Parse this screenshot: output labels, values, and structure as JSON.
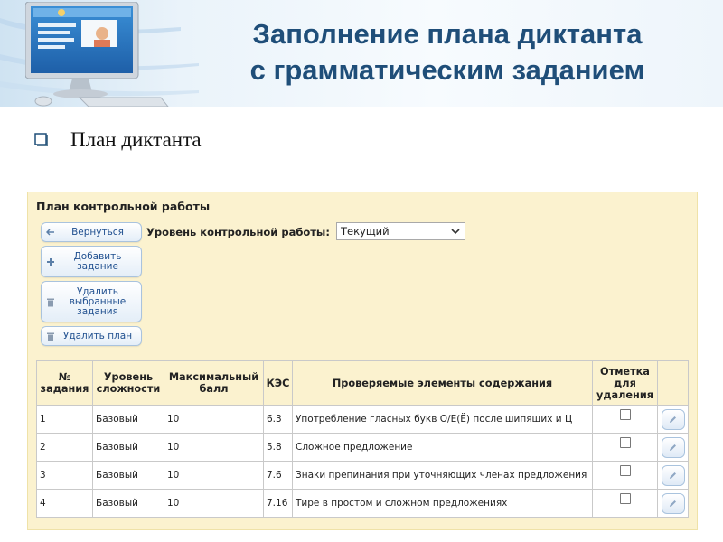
{
  "slide": {
    "title_line1": "Заполнение плана диктанта",
    "title_line2": "с грамматическим заданием",
    "bullet_text": "План диктанта"
  },
  "app": {
    "panel_title": "План контрольной работы",
    "buttons": {
      "back": "Вернуться",
      "add": "Добавить задание",
      "delete_selected": "Удалить выбранные задания",
      "delete_plan": "Удалить план"
    },
    "level_label": "Уровень контрольной работы:",
    "level_value": "Текущий",
    "table": {
      "headers": [
        "№ задания",
        "Уровень сложности",
        "Максимальный балл",
        "КЭС",
        "Проверяемые элементы содержания",
        "Отметка для удаления",
        ""
      ],
      "rows": [
        {
          "num": "1",
          "level": "Базовый",
          "score": "10",
          "kes": "6.3",
          "content": "Употребление гласных букв О/Е(Ё) после шипящих и Ц"
        },
        {
          "num": "2",
          "level": "Базовый",
          "score": "10",
          "kes": "5.8",
          "content": "Сложное предложение"
        },
        {
          "num": "3",
          "level": "Базовый",
          "score": "10",
          "kes": "7.6",
          "content": "Знаки препинания при уточняющих членах предложения"
        },
        {
          "num": "4",
          "level": "Базовый",
          "score": "10",
          "kes": "7.16",
          "content": "Тире в простом и сложном предложениях"
        }
      ]
    }
  },
  "colors": {
    "title": "#1f4e79",
    "panel_bg": "#fbf2cf",
    "button_text": "#1f4f8f"
  },
  "icons": {
    "back": "arrow-left-icon",
    "add": "plus-icon",
    "delete": "trash-icon",
    "edit": "pencil-icon",
    "bullet": "checkbox-bullet-icon",
    "dropdown": "chevron-down-icon",
    "logo": "computer-monitor-illustration"
  }
}
